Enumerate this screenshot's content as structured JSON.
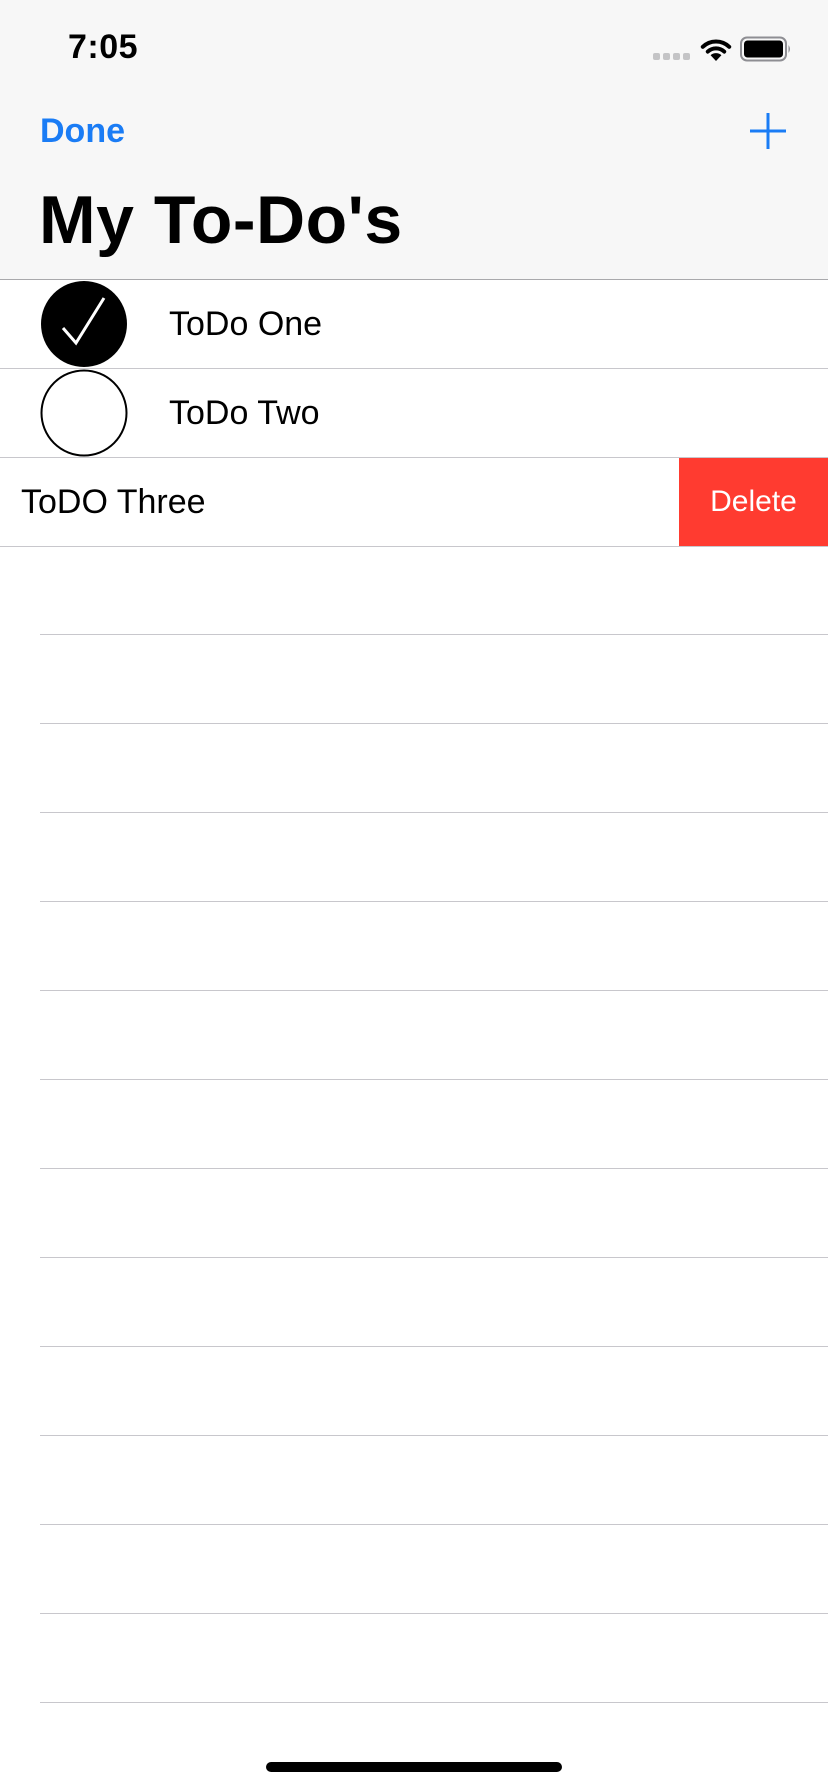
{
  "status_bar": {
    "time": "7:05",
    "signal_icon": "cellular-signal-icon",
    "wifi_icon": "wifi-icon",
    "battery_icon": "battery-icon"
  },
  "nav_bar": {
    "done_label": "Done",
    "add_icon": "plus-icon",
    "title": "My To-Do's",
    "accent_color": "#1a7cf5"
  },
  "todos": [
    {
      "label": "ToDo One",
      "completed": true
    },
    {
      "label": "ToDo Two",
      "completed": false
    },
    {
      "label": "ToDO Three",
      "swiped": true,
      "delete_label": "Delete",
      "delete_color": "#ff3b30"
    }
  ]
}
